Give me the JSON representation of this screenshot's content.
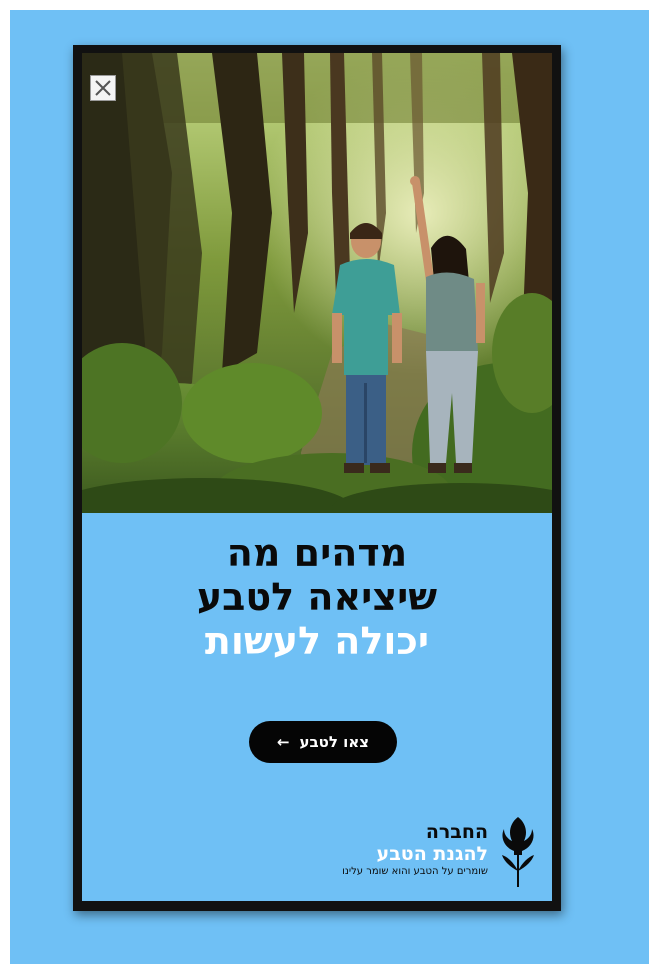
{
  "ad": {
    "headline_lines": [
      "מדהים מה",
      "שיציאה לטבע"
    ],
    "headline_highlight": "יכולה לעשות",
    "cta_label": "צאו לטבע",
    "cta_arrow": "←",
    "close_symbol": "×"
  },
  "organization": {
    "name_line1": "החברה",
    "name_line2": "להגנת הטבע",
    "tagline": "שומרים על הטבע והוא שומר עלינו"
  },
  "photo": {
    "subject": "forest-kids-image"
  },
  "colors": {
    "background": "#6fc0f5",
    "frame": "#111111",
    "headline_dark": "#0a0a0a",
    "headline_light": "#ffffff",
    "cta_background": "#050505",
    "cta_text": "#ffffff"
  }
}
